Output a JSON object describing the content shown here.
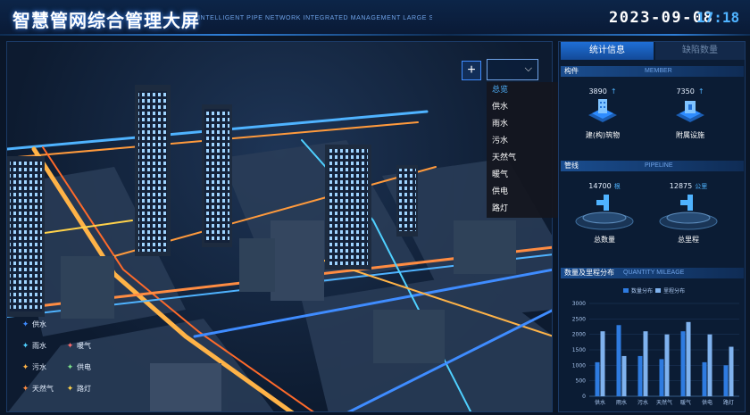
{
  "header": {
    "title": "智慧管网综合管理大屏",
    "subtitle": "INTELLIGENT PIPE NETWORK INTEGRATED MANAGEMENT LARGE S",
    "date": "2023-09-08",
    "time": "17:18"
  },
  "map": {
    "add_label": "+",
    "layer_dropdown": {
      "options": [
        "总览",
        "供水",
        "雨水",
        "污水",
        "天然气",
        "暖气",
        "供电",
        "路灯"
      ],
      "active_index": 0
    },
    "legend": [
      {
        "label": "供水",
        "color": "#3f8cff"
      },
      {
        "label": "雨水",
        "color": "#4fd0ff"
      },
      {
        "label": "暖气",
        "color": "#ff6b6b"
      },
      {
        "label": "污水",
        "color": "#ffb347"
      },
      {
        "label": "供电",
        "color": "#7be08a"
      },
      {
        "label": "天然气",
        "color": "#ff8c42"
      },
      {
        "label": "路灯",
        "color": "#ffd24a"
      }
    ]
  },
  "panel": {
    "tabs": [
      "统计信息",
      "缺陷数量"
    ],
    "member": {
      "title": "构件",
      "title_en": "MEMBER",
      "stats": [
        {
          "value": "3890",
          "label": "建(构)筑物"
        },
        {
          "value": "7350",
          "label": "附属设施"
        }
      ]
    },
    "pipeline": {
      "title": "管线",
      "title_en": "PIPELINE",
      "stats": [
        {
          "value": "14700",
          "unit": "根",
          "label": "总数量"
        },
        {
          "value": "12875",
          "unit": "公里",
          "label": "总里程"
        }
      ]
    },
    "quantity": {
      "title": "数量及里程分布",
      "title_en": "QUANTITY MILEAGE"
    }
  },
  "chart_data": {
    "type": "bar",
    "categories": [
      "供水",
      "雨水",
      "污水",
      "天然气",
      "暖气",
      "供电",
      "路灯"
    ],
    "series": [
      {
        "name": "数量分布",
        "values": [
          1100,
          2300,
          1300,
          1200,
          2100,
          1100,
          1000
        ],
        "color": "#2e7be0"
      },
      {
        "name": "里程分布",
        "values": [
          2100,
          1300,
          2100,
          2000,
          2400,
          2000,
          1600
        ],
        "color": "#7fb2ee"
      }
    ],
    "ylim": [
      0,
      3000
    ],
    "yticks": [
      0,
      500,
      1000,
      1500,
      2000,
      2500,
      3000
    ],
    "legend": "top-left"
  }
}
